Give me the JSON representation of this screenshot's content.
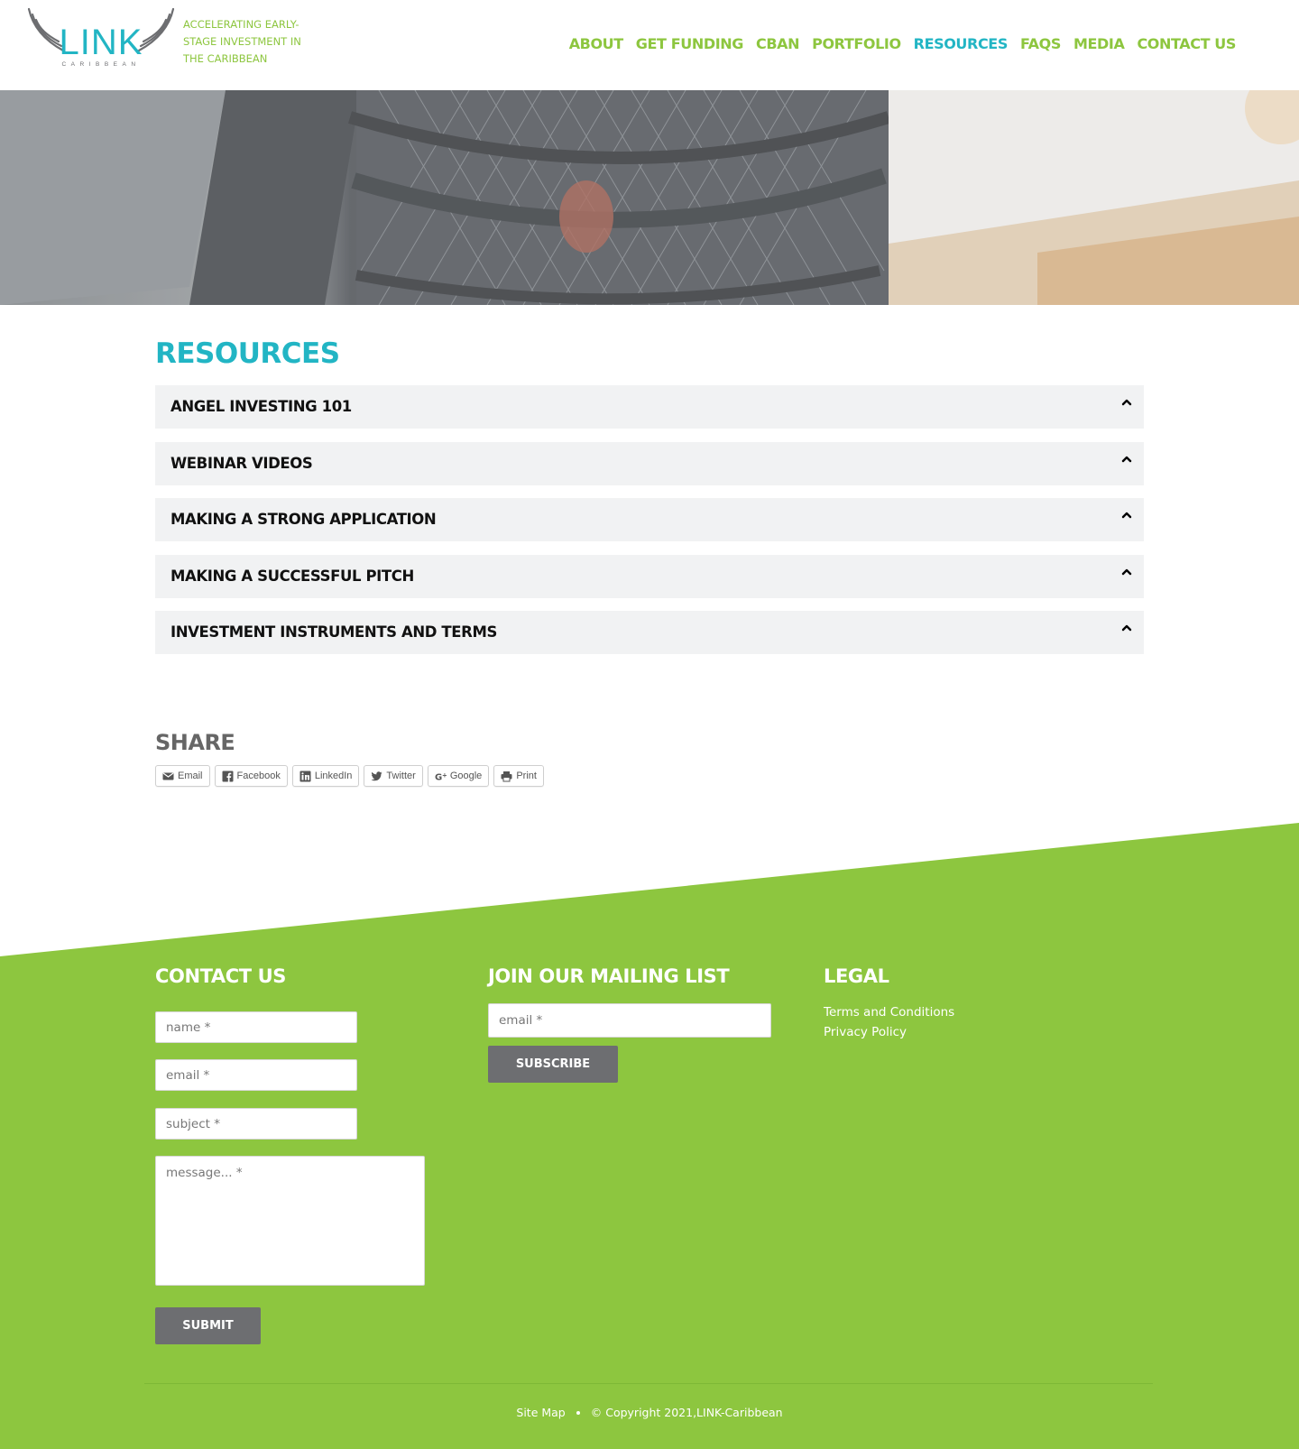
{
  "header": {
    "logo_text": "LINK",
    "logo_subtext": "CARIBBEAN",
    "tagline": "ACCELERATING EARLY-STAGE INVESTMENT IN THE CARIBBEAN",
    "nav": [
      {
        "label": "ABOUT",
        "active": false
      },
      {
        "label": "GET FUNDING",
        "active": false
      },
      {
        "label": "CBAN",
        "active": false
      },
      {
        "label": "PORTFOLIO",
        "active": false
      },
      {
        "label": "RESOURCES",
        "active": true
      },
      {
        "label": "FAQS",
        "active": false
      },
      {
        "label": "MEDIA",
        "active": false
      },
      {
        "label": "CONTACT US",
        "active": false
      }
    ]
  },
  "main": {
    "title": "RESOURCES",
    "accordion": [
      {
        "label": "ANGEL INVESTING 101",
        "icon": "chevron-up-icon"
      },
      {
        "label": "WEBINAR VIDEOS",
        "icon": "chevron-up-icon"
      },
      {
        "label": "MAKING A STRONG APPLICATION",
        "icon": "chevron-up-icon"
      },
      {
        "label": "MAKING A SUCCESSFUL PITCH",
        "icon": "chevron-up-icon"
      },
      {
        "label": "INVESTMENT INSTRUMENTS AND TERMS",
        "icon": "chevron-up-icon"
      }
    ]
  },
  "share": {
    "title": "SHARE",
    "buttons": [
      {
        "label": "Email",
        "icon": "email-icon"
      },
      {
        "label": "Facebook",
        "icon": "facebook-icon"
      },
      {
        "label": "LinkedIn",
        "icon": "linkedin-icon"
      },
      {
        "label": "Twitter",
        "icon": "twitter-icon"
      },
      {
        "label": "Google",
        "icon": "google-plus-icon"
      },
      {
        "label": "Print",
        "icon": "print-icon"
      }
    ]
  },
  "footer": {
    "contact": {
      "heading": "CONTACT US",
      "name_placeholder": "name *",
      "email_placeholder": "email *",
      "subject_placeholder": "subject *",
      "message_placeholder": "message... *",
      "submit_label": "SUBMIT"
    },
    "mailing": {
      "heading": "JOIN OUR MAILING LIST",
      "email_placeholder": "email *",
      "subscribe_label": "SUBSCRIBE"
    },
    "legal": {
      "heading": "LEGAL",
      "links": [
        "Terms and Conditions",
        "Privacy Policy"
      ]
    },
    "bottom": {
      "sitemap": "Site Map",
      "copyright": "© Copyright 2021,LINK-Caribbean"
    }
  },
  "colors": {
    "brand_green": "#8dc63f",
    "brand_teal": "#22b5c4",
    "button_gray": "#6d6e71"
  }
}
